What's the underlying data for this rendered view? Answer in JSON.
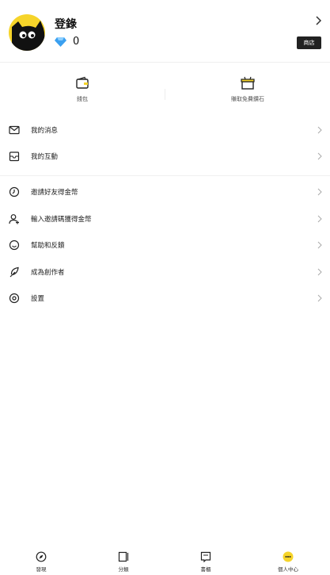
{
  "profile": {
    "login_label": "登錄",
    "gem_count": "0",
    "shop_label": "商店"
  },
  "quick_actions": [
    {
      "label": "錢包",
      "icon": "wallet-icon"
    },
    {
      "label": "賺取免費鑽石",
      "icon": "gift-box-icon"
    }
  ],
  "menu": [
    {
      "label": "我的消息",
      "icon": "mail-icon"
    },
    {
      "label": "我的互動",
      "icon": "interaction-inbox-icon"
    },
    {
      "label": "邀請好友得金幣",
      "icon": "invite-clock-icon"
    },
    {
      "label": "輸入邀請碼獲得金幣",
      "icon": "add-user-icon"
    },
    {
      "label": "幫助和反饋",
      "icon": "help-smile-icon"
    },
    {
      "label": "成為創作者",
      "icon": "feather-icon"
    },
    {
      "label": "設置",
      "icon": "settings-icon"
    }
  ],
  "tabbar": [
    {
      "label": "發現",
      "icon": "compass-icon"
    },
    {
      "label": "分類",
      "icon": "category-book-icon"
    },
    {
      "label": "書櫃",
      "icon": "bookshelf-icon"
    },
    {
      "label": "個人中心",
      "icon": "profile-face-icon",
      "active": true
    }
  ],
  "colors": {
    "accent": "#f6d42a",
    "gem": "#3aa0f0",
    "shop_button": "#222222"
  }
}
